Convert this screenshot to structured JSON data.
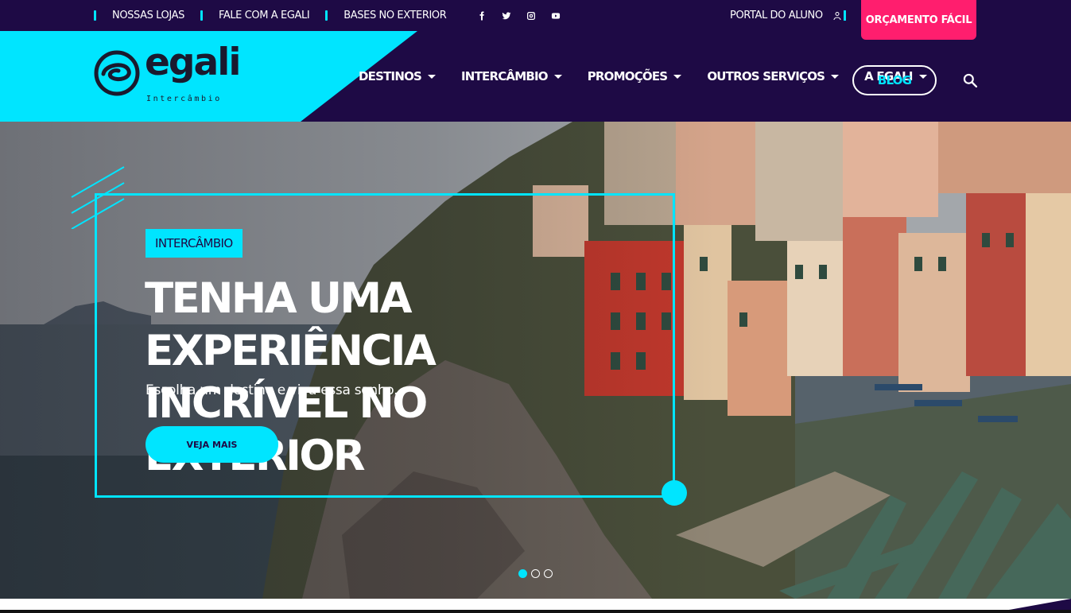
{
  "topbar": {
    "links": [
      "NOSSAS LOJAS",
      "FALE COM A EGALI",
      "BASES NO EXTERIOR"
    ],
    "socials": [
      "facebook-icon",
      "twitter-icon",
      "instagram-icon",
      "youtube-icon"
    ],
    "portal_label": "PORTAL DO ALUNO",
    "orcamento_label": "ORÇAMENTO FÁCIL"
  },
  "logo": {
    "word": "egali",
    "sub": "Intercâmbio"
  },
  "nav": {
    "items": [
      "DESTINOS",
      "INTERCÂMBIO",
      "PROMOÇÕES",
      "OUTROS SERVIÇOS",
      "A EGALI"
    ],
    "blog_label": "BLOG"
  },
  "hero": {
    "tag": "INTERCÂMBIO",
    "headline_line1": "TENHA UMA EXPERIÊNCIA",
    "headline_line2": "INCRÍVEL NO EXTERIOR",
    "subline": "Escolha um destino e viva essa sonho.",
    "cta_label": "VEJA MAIS",
    "slides_total": 3,
    "active_slide": 1
  },
  "colors": {
    "accent": "#00e5ff",
    "dark": "#1e0a45",
    "pink": "#ff1e6e"
  }
}
